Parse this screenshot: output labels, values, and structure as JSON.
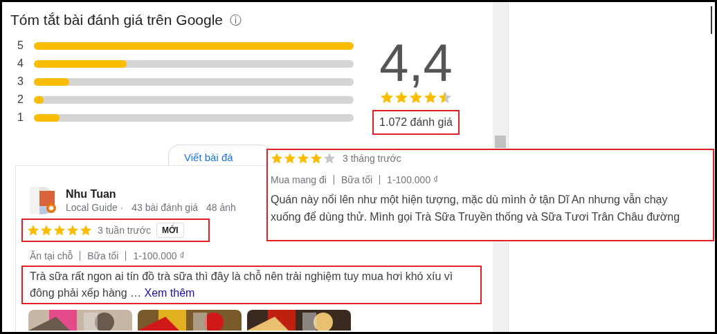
{
  "summary": {
    "title": "Tóm tắt bài đánh giá trên Google",
    "info_icon": "ⓘ",
    "bars": [
      {
        "label": "5",
        "level": 1.0
      },
      {
        "label": "4",
        "level": 0.29
      },
      {
        "label": "3",
        "level": 0.11
      },
      {
        "label": "2",
        "level": 0.03
      },
      {
        "label": "1",
        "level": 0.08
      }
    ],
    "average": "4,4",
    "stars": 4.5,
    "count": "1.072 đánh giá"
  },
  "write_button": {
    "label": "Viết bài đá"
  },
  "review": {
    "author": "Nhu Tuan",
    "meta": [
      "Local Guide ·",
      "43 bài đánh giá",
      "48 ảnh"
    ],
    "stars": 5,
    "time": "3 tuần trước",
    "badge": "MỚI",
    "tags": [
      "Ăn tại chỗ",
      "Bữa tối",
      "1-100.000 ₫"
    ],
    "text": "Trà sữa rất ngon ai tín đồ trà sữa thì đây là chỗ nên trải nghiệm tuy mua hơi khó xíu vì đông phải xếp hàng …",
    "more": "Xem thêm",
    "photos": [
      {
        "kind": "picture"
      },
      {
        "kind": "picture"
      },
      {
        "kind": "picture"
      }
    ]
  },
  "overlay_review": {
    "stars": 4,
    "time": "3 tháng trước",
    "tags": [
      "Mua mang đi",
      "Bữa tối",
      "1-100.000 ₫"
    ],
    "lines": [
      "Quán này nổi lên như một hiện tượng, mặc dù mình ở tận Dĩ An nhưng vẫn chạy",
      "xuống để dùng thử. Mình gọi Trà Sữa Truyền thống và Sữa Tươi Trân Châu đường"
    ]
  }
}
